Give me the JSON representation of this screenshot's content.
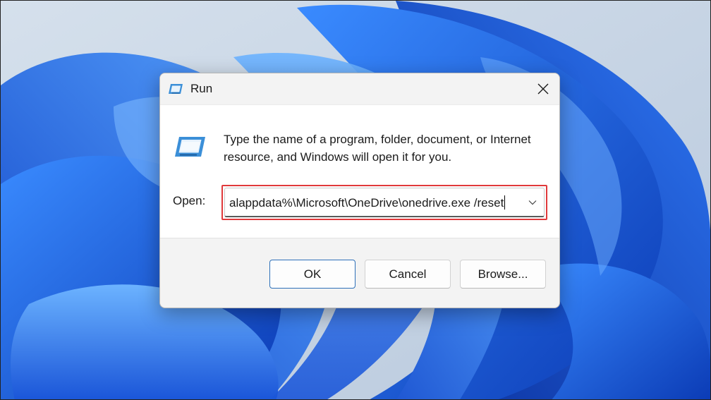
{
  "window": {
    "title": "Run",
    "close_glyph": "✕"
  },
  "content": {
    "description": "Type the name of a program, folder, document, or Internet resource, and Windows will open it for you.",
    "open_label": "Open:",
    "command_value": "alappdata%\\Microsoft\\OneDrive\\onedrive.exe /reset"
  },
  "buttons": {
    "ok": "OK",
    "cancel": "Cancel",
    "browse": "Browse..."
  },
  "icons": {
    "title": "run-icon",
    "big": "run-icon",
    "close": "close-icon",
    "dropdown": "chevron-down-icon"
  },
  "colors": {
    "highlight": "#e0393b",
    "accent": "#2c6fb8",
    "wallpaper_blue": "#1f5fe0"
  }
}
